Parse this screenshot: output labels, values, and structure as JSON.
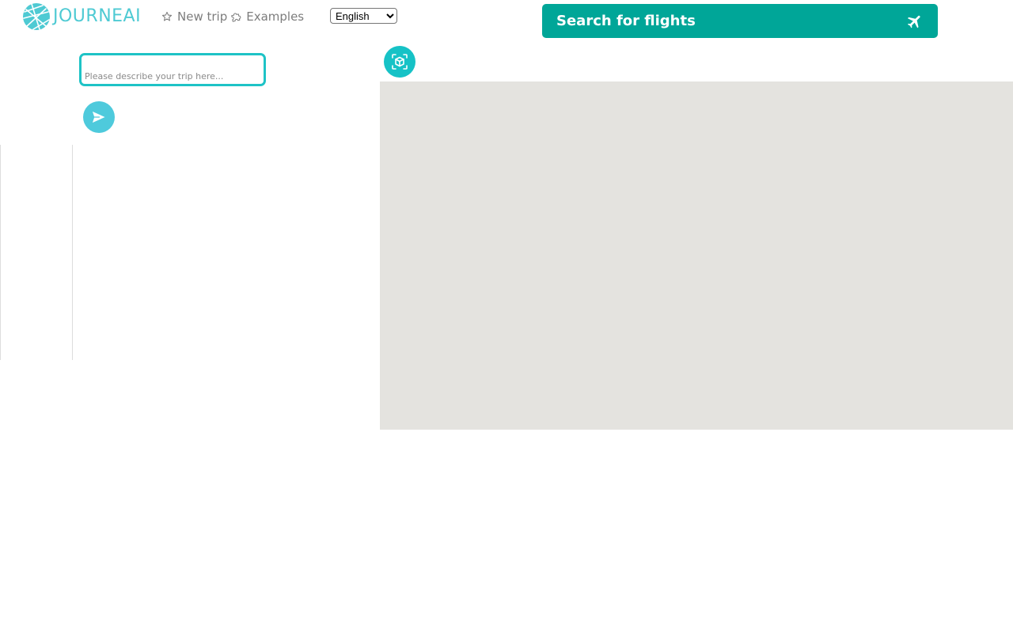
{
  "app": {
    "brand_name": "JOURNEAI",
    "brand_color": "#4ecad3"
  },
  "nav": {
    "new_trip_label": "New trip",
    "new_trip_icon": "star-icon",
    "examples_label": "Examples",
    "examples_icon": "puzzle-icon"
  },
  "language": {
    "selected": "English",
    "options": [
      "English"
    ]
  },
  "flights": {
    "label": "Search for flights",
    "icon": "airplane-icon",
    "color": "#00a698"
  },
  "trip": {
    "placeholder": "Please describe your trip here...",
    "value": ""
  },
  "send": {
    "icon": "send-icon",
    "color": "#4ecadc"
  },
  "ar_view": {
    "icon": "cube-scan-icon",
    "color": "#16c2c6"
  },
  "map": {
    "background": "#e4e3df"
  }
}
